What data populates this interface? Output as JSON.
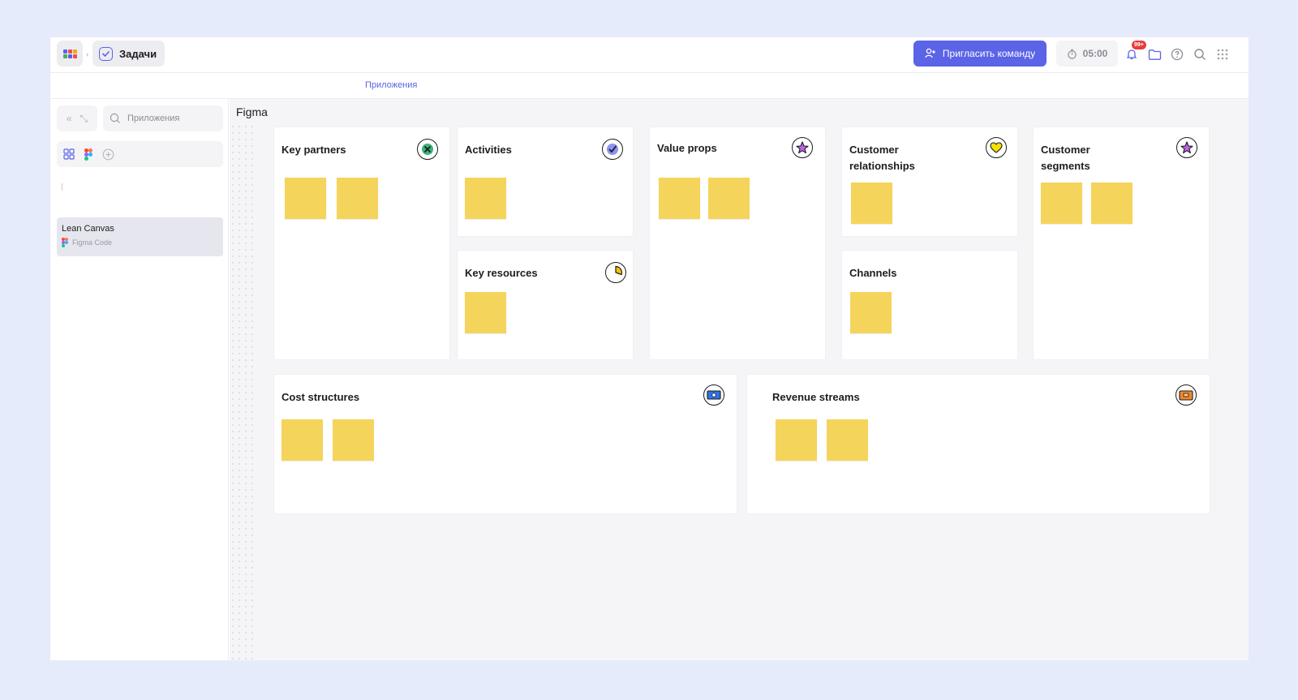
{
  "topbar": {
    "breadcrumb_label": "Задачи",
    "invite_label": "Пригласить команду",
    "timer": "05:00",
    "notifications_badge": "99+",
    "apps_grid_colors": [
      "#5b63e6",
      "#e9524a",
      "#f5a623",
      "#4cae5b",
      "#5b63e6",
      "#e9524a"
    ]
  },
  "tabs": {
    "apps_label": "Приложения"
  },
  "sidebar": {
    "search_placeholder": "Приложения",
    "board": {
      "name": "Lean Canvas",
      "source": "Figma Code"
    }
  },
  "canvas": {
    "frame_label": "Figma",
    "cards": {
      "key_partners": {
        "title": "Key partners",
        "icon": "x-circle-icon",
        "icon_color": "#3bb37a",
        "stickies": 2
      },
      "activities": {
        "title": "Activities",
        "icon": "check-circle-icon",
        "icon_color": "#5b63e6",
        "stickies": 1
      },
      "key_resources": {
        "title": "Key resources",
        "icon": "pie-chart-icon",
        "icon_color": "#f5c400",
        "stickies": 1
      },
      "value_props": {
        "title": "Value props",
        "icon": "star-icon",
        "icon_color": "#b44fe0",
        "stickies": 2
      },
      "customer_relationships": {
        "title": "Customer relationships",
        "icon": "heart-icon",
        "icon_color": "#f5e000",
        "stickies": 1
      },
      "channels": {
        "title": "Channels",
        "stickies": 1
      },
      "customer_segments": {
        "title": "Customer segments",
        "icon": "star-icon",
        "icon_color": "#b44fe0",
        "stickies": 2
      },
      "cost_structures": {
        "title": "Cost structures",
        "icon": "banknote-icon",
        "icon_color": "#2f73e6",
        "stickies": 2
      },
      "revenue_streams": {
        "title": "Revenue streams",
        "icon": "wallet-icon",
        "icon_color": "#f08a2c",
        "stickies": 2
      }
    },
    "sticky_color": "#f5d45c"
  }
}
